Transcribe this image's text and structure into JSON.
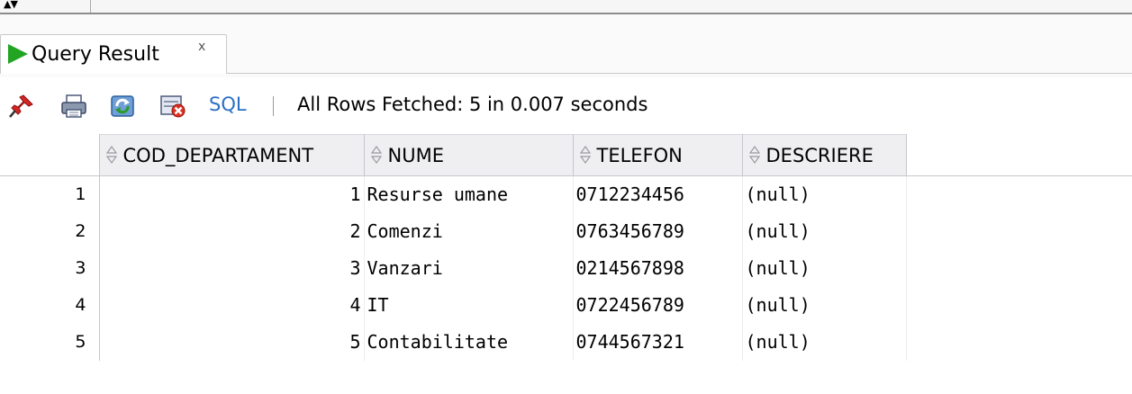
{
  "tab": {
    "label": "Query Result",
    "close": "x"
  },
  "toolbar": {
    "icons": [
      "pin-icon",
      "print-icon",
      "refresh-icon",
      "cancel-icon"
    ],
    "sql_label": "SQL",
    "status": "All Rows Fetched: 5 in 0.007 seconds"
  },
  "grid": {
    "columns": [
      "COD_DEPARTAMENT",
      "NUME",
      "TELEFON",
      "DESCRIERE"
    ],
    "rows": [
      {
        "num": "1",
        "cod": "1",
        "nume": "Resurse umane",
        "telefon": "0712234456",
        "descriere": "(null)"
      },
      {
        "num": "2",
        "cod": "2",
        "nume": "Comenzi",
        "telefon": "0763456789",
        "descriere": "(null)"
      },
      {
        "num": "3",
        "cod": "3",
        "nume": "Vanzari",
        "telefon": "0214567898",
        "descriere": "(null)"
      },
      {
        "num": "4",
        "cod": "4",
        "nume": "IT",
        "telefon": "0722456789",
        "descriere": "(null)"
      },
      {
        "num": "5",
        "cod": "5",
        "nume": "Contabilitate",
        "telefon": "0744567321",
        "descriere": "(null)"
      }
    ]
  },
  "colors": {
    "run_icon": "#22a522",
    "sql_link": "#2b6fc4",
    "header_bg": "#efeff2"
  }
}
